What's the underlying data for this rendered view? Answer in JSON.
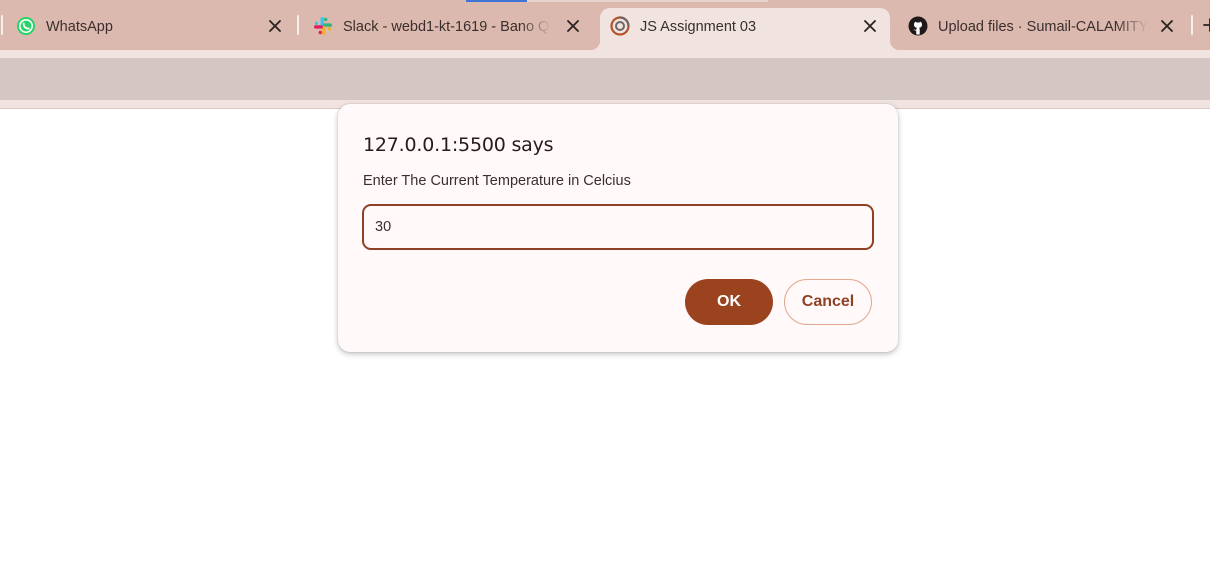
{
  "browser": {
    "tabs": [
      {
        "title": "WhatsApp",
        "icon": "whatsapp-icon",
        "active": false
      },
      {
        "title": "Slack - webd1-kt-1619 - Bano Q",
        "icon": "slack-icon",
        "active": false
      },
      {
        "title": "JS Assignment 03",
        "icon": "live-server-icon",
        "active": true
      },
      {
        "title": "Upload files · Sumail-CALAMITY",
        "icon": "github-icon",
        "active": false
      }
    ],
    "colors": {
      "tabstrip": "#dcb9ae",
      "active_tab": "#f1e4e0",
      "toolbar": "#d3c6c3"
    }
  },
  "dialog": {
    "heading": "127.0.0.1:5500 says",
    "message": "Enter The Current Temperature in Celcius",
    "input_value": "30",
    "ok_label": "OK",
    "cancel_label": "Cancel",
    "colors": {
      "accent": "#9b431f",
      "cancel_border": "#e3a88f",
      "background": "#fff9fa"
    }
  }
}
